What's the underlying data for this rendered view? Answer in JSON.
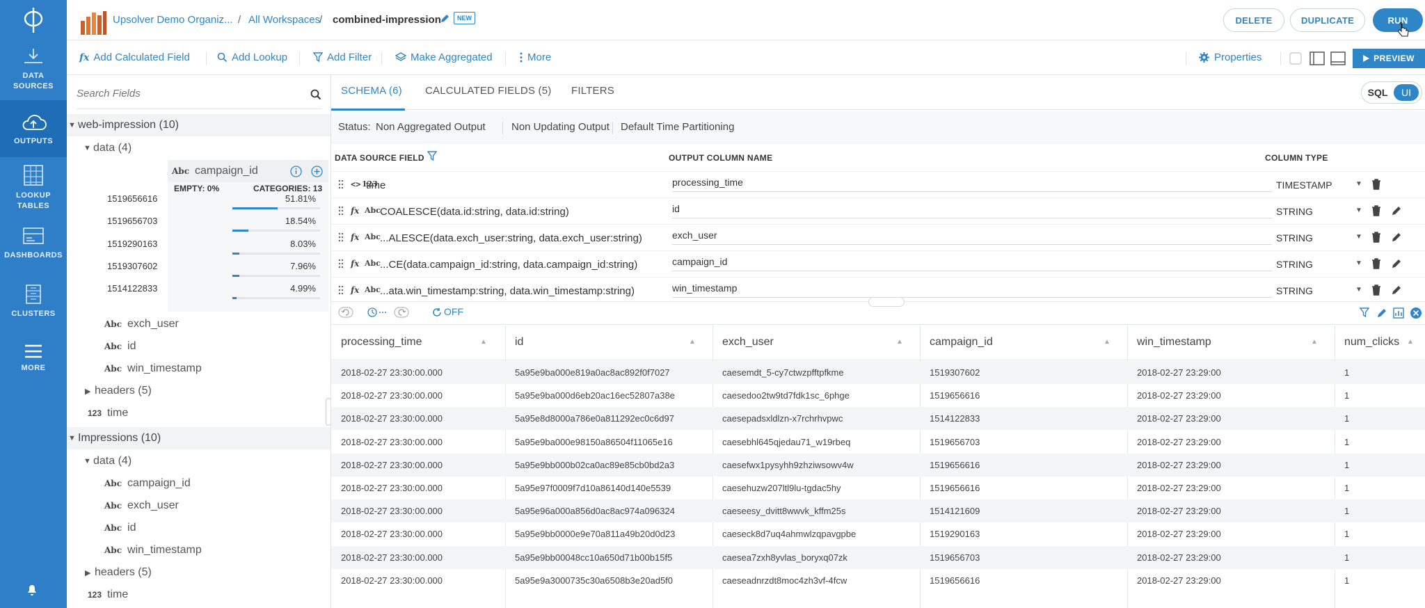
{
  "rail": {
    "items": [
      {
        "label1": "DATA",
        "label2": "SOURCES"
      },
      {
        "label1": "OUTPUTS",
        "label2": ""
      },
      {
        "label1": "LOOKUP",
        "label2": "TABLES"
      },
      {
        "label1": "DASHBOARDS",
        "label2": ""
      },
      {
        "label1": "CLUSTERS",
        "label2": ""
      },
      {
        "label1": "MORE",
        "label2": ""
      }
    ]
  },
  "header": {
    "org": "Upsolver Demo Organiz...",
    "sep1": "/",
    "workspaces": "All Workspaces",
    "sep2": "/",
    "output_name": "combined-impression",
    "badge": "NEW",
    "buttons": {
      "delete": "DELETE",
      "duplicate": "DUPLICATE",
      "run": "RUN"
    }
  },
  "toolbar": {
    "add_calculated_field": "Add Calculated Field",
    "fx_icon": "fx",
    "add_lookup": "Add Lookup",
    "add_filter": "Add Filter",
    "make_aggregated": "Make Aggregated",
    "more": "More",
    "properties": "Properties",
    "preview": "PREVIEW"
  },
  "fields": {
    "search_placeholder": "Search Fields",
    "groups": [
      {
        "name": "web-impression (10)"
      },
      {
        "name": "Impressions (10)"
      }
    ],
    "web": {
      "data": "data (4)",
      "selected": "campaign_id",
      "stats": {
        "empty_label": "EMPTY: 0%",
        "categories_label": "CATEGORIES: 13"
      },
      "values": [
        {
          "value": "1519656616",
          "pct_text": "51.81%",
          "pct": 51.81
        },
        {
          "value": "1519656703",
          "pct_text": "18.54%",
          "pct": 18.54
        },
        {
          "value": "1519290163",
          "pct_text": "8.03%",
          "pct": 8.03
        },
        {
          "value": "1519307602",
          "pct_text": "7.96%",
          "pct": 7.96
        },
        {
          "value": "1514122833",
          "pct_text": "4.99%",
          "pct": 4.99
        }
      ],
      "fields": [
        "exch_user",
        "id",
        "win_timestamp"
      ],
      "headers": "headers (5)",
      "time": "time"
    },
    "impressions": {
      "data": "data (4)",
      "fields": [
        "campaign_id",
        "exch_user",
        "id",
        "win_timestamp"
      ],
      "headers": "headers (5)",
      "time": "time"
    },
    "type_abc": "Abc",
    "type_num": "123"
  },
  "main": {
    "tabs": [
      "SCHEMA (6)",
      "CALCULATED FIELDS (5)",
      "FILTERS"
    ],
    "toggle": {
      "sql": "SQL",
      "ui": "UI"
    },
    "status": {
      "label": "Status:",
      "items": [
        "Non Aggregated Output",
        "Non Updating Output",
        "Default Time Partitioning"
      ]
    },
    "schema_headers": {
      "source": "DATA SOURCE FIELD",
      "output": "OUTPUT COLUMN NAME",
      "type": "COLUMN TYPE"
    },
    "schema_rows": [
      {
        "prefix": "<>",
        "type": "123",
        "source": "time",
        "output": "processing_time",
        "col_type": "TIMESTAMP"
      },
      {
        "prefix": "fx",
        "type": "Abc",
        "source": "COALESCE(data.id:string, data.id:string)",
        "output": "id",
        "col_type": "STRING"
      },
      {
        "prefix": "fx",
        "type": "Abc",
        "source": "...ALESCE(data.exch_user:string, data.exch_user:string)",
        "output": "exch_user",
        "col_type": "STRING"
      },
      {
        "prefix": "fx",
        "type": "Abc",
        "source": "...CE(data.campaign_id:string, data.campaign_id:string)",
        "output": "campaign_id",
        "col_type": "STRING"
      },
      {
        "prefix": "fx",
        "type": "Abc",
        "source": "...ata.win_timestamp:string, data.win_timestamp:string)",
        "output": "win_timestamp",
        "col_type": "STRING"
      }
    ],
    "auto_refresh": "OFF",
    "grid": {
      "columns": [
        "processing_time",
        "id",
        "exch_user",
        "campaign_id",
        "win_timestamp",
        "num_clicks"
      ],
      "rows": [
        [
          "2018-02-27 23:30:00.000",
          "5a95e9ba000e819a0ac8ac892f0f7027",
          "caesemdt_5-cy7ctwzpfftpfkme",
          "1519307602",
          "2018-02-27 23:29:00",
          "1"
        ],
        [
          "2018-02-27 23:30:00.000",
          "5a95e9ba000d6eb20ac16ec52807a38e",
          "caesedoo2tw9td7fdk1sc_6phge",
          "1519656616",
          "2018-02-27 23:29:00",
          "1"
        ],
        [
          "2018-02-27 23:30:00.000",
          "5a95e8d8000a786e0a811292ec0c6d97",
          "caesepadsxldlzn-x7rchrhvpwc",
          "1514122833",
          "2018-02-27 23:29:00",
          "1"
        ],
        [
          "2018-02-27 23:30:00.000",
          "5a95e9ba000e98150a86504f11065e16",
          "caesebhl645qjedau71_w19rbeq",
          "1519656703",
          "2018-02-27 23:29:00",
          "1"
        ],
        [
          "2018-02-27 23:30:00.000",
          "5a95e9bb000b02ca0ac89e85cb0bd2a3",
          "caesefwx1pysyhh9zhziwsowv4w",
          "1519656616",
          "2018-02-27 23:29:00",
          "1"
        ],
        [
          "2018-02-27 23:30:00.000",
          "5a95e97f0009f7d10a86140d140e5539",
          "caesehuzw207ltl9lu-tgdac5hy",
          "1519656616",
          "2018-02-27 23:29:00",
          "1"
        ],
        [
          "2018-02-27 23:30:00.000",
          "5a95e96a000a856d0ac8ac974a096324",
          "caeseesy_dvitt8wwvk_kffm25s",
          "1514121609",
          "2018-02-27 23:29:00",
          "1"
        ],
        [
          "2018-02-27 23:30:00.000",
          "5a95e9bb0000e9e70a811a49b20d0d23",
          "caeseck8d7uq4ahmwlzqpavgpbe",
          "1519290163",
          "2018-02-27 23:29:00",
          "1"
        ],
        [
          "2018-02-27 23:30:00.000",
          "5a95e9bb00048cc10a650d71b00b15f5",
          "caesea7zxh8yvlas_boryxq07zk",
          "1519656703",
          "2018-02-27 23:29:00",
          "1"
        ],
        [
          "2018-02-27 23:30:00.000",
          "5a95e9a3000735c30a6508b3e20ad5f0",
          "caeseadnrzdt8moc4zh3vf-4fcw",
          "1519656616",
          "2018-02-27 23:29:00",
          "1"
        ]
      ]
    }
  },
  "colors": {
    "brand": "#2f86c7",
    "rail": "#2f7fc8",
    "rail_active": "#1e6db5"
  }
}
